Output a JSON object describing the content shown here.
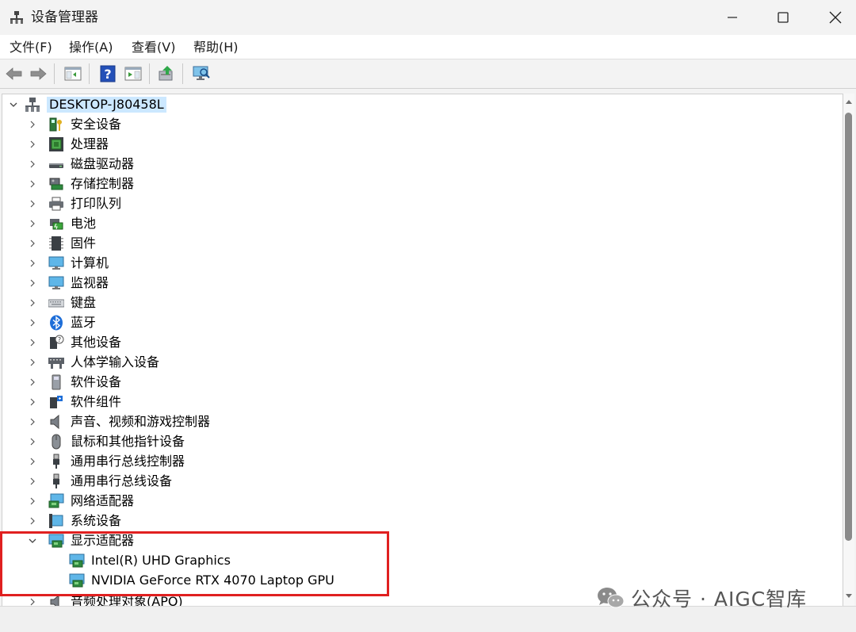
{
  "window": {
    "title": "设备管理器"
  },
  "menu": [
    "文件(F)",
    "操作(A)",
    "查看(V)",
    "帮助(H)"
  ],
  "tree": {
    "root": "DESKTOP-J80458L",
    "categories": [
      "安全设备",
      "处理器",
      "磁盘驱动器",
      "存储控制器",
      "打印队列",
      "电池",
      "固件",
      "计算机",
      "监视器",
      "键盘",
      "蓝牙",
      "其他设备",
      "人体学输入设备",
      "软件设备",
      "软件组件",
      "声音、视频和游戏控制器",
      "鼠标和其他指针设备",
      "通用串行总线控制器",
      "通用串行总线设备",
      "网络适配器",
      "系统设备",
      "显示适配器"
    ],
    "display_adapters": [
      "Intel(R) UHD Graphics",
      "NVIDIA GeForce RTX 4070 Laptop GPU"
    ],
    "cut_off_item": "音频处理对象(APO)"
  },
  "watermark": "公众号 · AIGC智库",
  "colors": {
    "selection": "#cce8ff",
    "highlight_box": "#e02020",
    "scroll_thumb": "#8a8a8a"
  }
}
